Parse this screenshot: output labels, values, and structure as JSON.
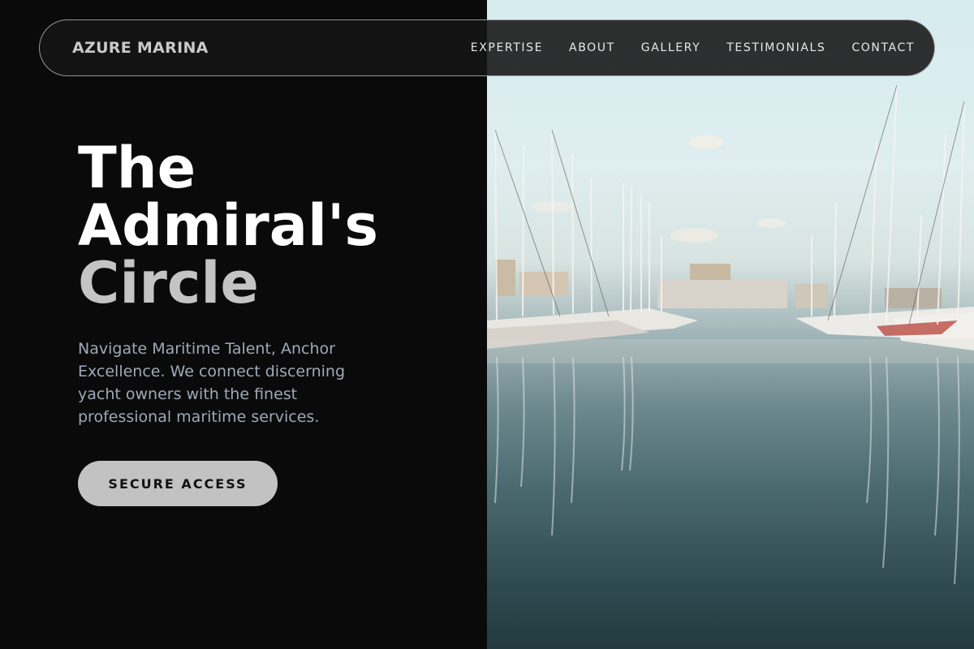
{
  "brand": {
    "name": "AZURE MARINA"
  },
  "nav": {
    "items": [
      {
        "label": "EXPERTISE"
      },
      {
        "label": "ABOUT"
      },
      {
        "label": "GALLERY"
      },
      {
        "label": "TESTIMONIALS"
      },
      {
        "label": "CONTACT"
      }
    ]
  },
  "hero": {
    "title_line_1": "The",
    "title_line_2": "Admiral's",
    "title_line_3": "Circle",
    "subtitle": "Navigate Maritime Talent, Anchor Excellence. We connect discerning yacht owners with the finest professional maritime services.",
    "cta_label": "SECURE ACCESS"
  },
  "colors": {
    "background": "#0a0a0a",
    "accent_button": "#c2c2c2",
    "subtitle_text": "#9fa9b8"
  }
}
